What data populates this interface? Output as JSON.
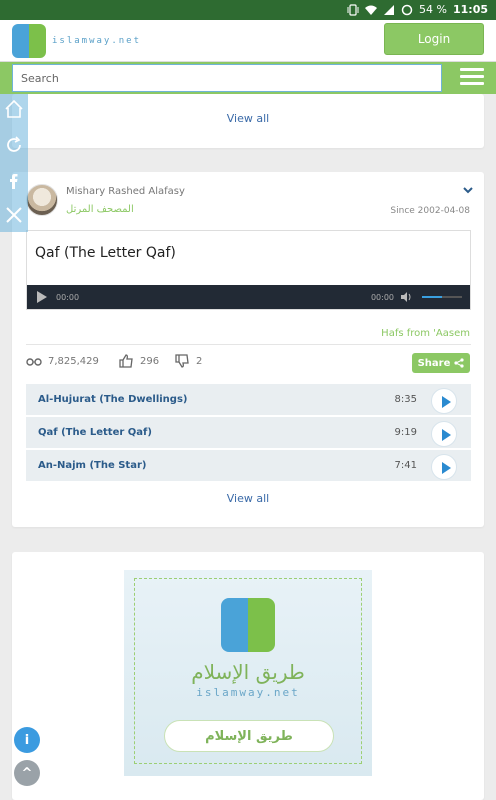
{
  "status": {
    "battery": "54 %",
    "time": "11:05"
  },
  "header": {
    "logo_text": "islamway.net",
    "login_label": "Login"
  },
  "search": {
    "placeholder": "Search"
  },
  "card1": {
    "view_all": "View all"
  },
  "recitation": {
    "reciter_name": "Mishary Rashed Alafasy",
    "reciter_arabic": "المصحف المرتل",
    "since": "Since 2002-04-08",
    "title": "Qaf (The Letter Qaf)",
    "time_current": "00:00",
    "time_total": "00:00",
    "volume": 0.5,
    "rewaya": "Hafs from 'Aasem",
    "views": "7,825,429",
    "likes": "296",
    "dislikes": "2",
    "share_label": "Share",
    "tracks": [
      {
        "name": "Al-Hujurat (The Dwellings)",
        "duration": "8:35"
      },
      {
        "name": "Qaf (The Letter Qaf)",
        "duration": "9:19"
      },
      {
        "name": "An-Najm (The Star)",
        "duration": "7:41"
      }
    ],
    "view_all": "View all"
  },
  "banner": {
    "arabic": "طريق الإسلام",
    "latin": "islamway.net",
    "button": "طريق الإسلام"
  },
  "fab": {
    "info": "i",
    "top": "^"
  },
  "colors": {
    "brand_green": "#8cc864",
    "brand_blue": "#4aa3d8",
    "status_bar": "#2e6b31",
    "link": "#3a6aa8"
  }
}
